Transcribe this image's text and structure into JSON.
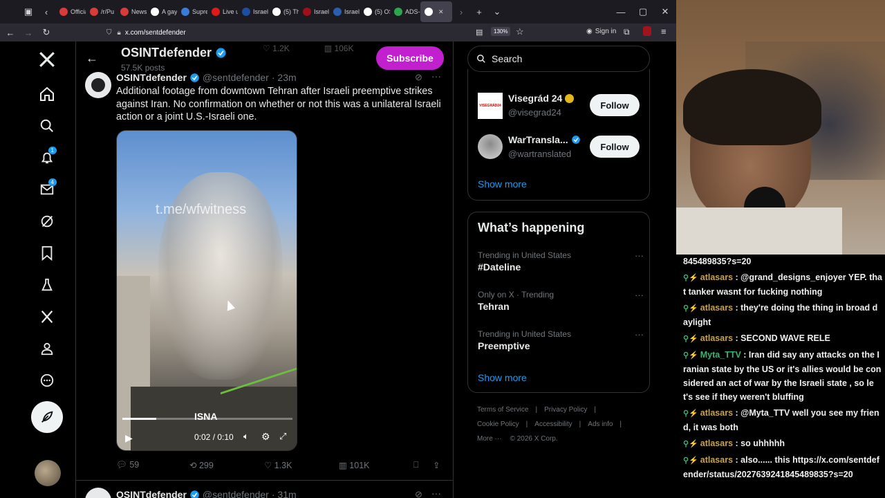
{
  "browser": {
    "tabs": [
      {
        "label": "Officia",
        "color": "#d93a3a"
      },
      {
        "label": "/r/Pu",
        "color": "#d93a3a"
      },
      {
        "label": "News",
        "color": "#d93a3a"
      },
      {
        "label": "A gay",
        "color": "#ffffff"
      },
      {
        "label": "Supre",
        "color": "#3a7bd5"
      },
      {
        "label": "Live u",
        "color": "#e01a1a"
      },
      {
        "label": "Israel",
        "color": "#1d4fa0"
      },
      {
        "label": "(5) Th",
        "color": "#ffffff"
      },
      {
        "label": "Israel",
        "color": "#a0101a"
      },
      {
        "label": "Israel",
        "color": "#2a5fb0"
      },
      {
        "label": "(5) OS",
        "color": "#ffffff"
      },
      {
        "label": "ADS-",
        "color": "#2ea44f"
      },
      {
        "label": "",
        "color": "#ffffff"
      }
    ],
    "url": "x.com/sentdefender",
    "zoom": "130%",
    "sign_in": "Sign in"
  },
  "header": {
    "name": "OSINTdefender",
    "posts": "57.5K posts",
    "subscribe": "Subscribe",
    "prev_stats": {
      "likes": "1.2K",
      "views": "106K"
    }
  },
  "tweet": {
    "name": "OSINTdefender",
    "handle": "@sentdefender",
    "time": "· 23m",
    "text": "Additional footage from downtown Tehran after Israeli preemptive strikes against Iran. No confirmation on whether or not this was a unilateral Israeli action or a joint U.S.-Israeli one.",
    "video": {
      "watermark": "t.me/wfwitness",
      "source": "ISNA",
      "time": "0:02 / 0:10",
      "progress": 0.2
    },
    "stats": {
      "replies": "59",
      "reposts": "299",
      "likes": "1.3K",
      "views": "101K"
    }
  },
  "next_tweet": {
    "name": "OSINTdefender",
    "handle": "@sentdefender",
    "time": "· 31m"
  },
  "nav": {
    "notifications_badge": "1",
    "messages_badge": "4"
  },
  "search": {
    "placeholder": "Search"
  },
  "who_to_follow": [
    {
      "name": "Visegrád 24",
      "handle": "@visegrad24",
      "follow": "Follow",
      "avatar_text": "VISEGRÁD24"
    },
    {
      "name": "WarTransla...",
      "handle": "@wartranslated",
      "follow": "Follow"
    }
  ],
  "show_more_1": "Show more",
  "whats_happening": {
    "title": "What’s happening",
    "trends": [
      {
        "meta": "Trending in United States",
        "name": "#Dateline"
      },
      {
        "meta": "Only on X · Trending",
        "name": "Tehran"
      },
      {
        "meta": "Trending in United States",
        "name": "Preemptive"
      }
    ],
    "show_more": "Show more"
  },
  "footer": {
    "terms": "Terms of Service",
    "privacy": "Privacy Policy",
    "cookie": "Cookie Policy",
    "accessibility": "Accessibility",
    "ads": "Ads info",
    "more": "More ···",
    "copyright": "© 2026 X Corp."
  },
  "chat": [
    {
      "user": "",
      "text": "845489835?s=20"
    },
    {
      "user": "atlasars",
      "text": "@grand_designs_enjoyer YEP. that tanker wasnt for fucking nothing"
    },
    {
      "user": "atlasars",
      "text": "they're doing the thing in broad daylight"
    },
    {
      "user": "atlasars",
      "text": "SECOND WAVE RELE"
    },
    {
      "user": "Myta_TTV",
      "text": "Iran did say any attacks on the Iranian state by the US or it's allies would be considered an act of war by the Israeli state , so let's see if they weren't bluffing"
    },
    {
      "user": "atlasars",
      "text": "@Myta_TTV well you see my friend, it was both"
    },
    {
      "user": "atlasars",
      "text": "so uhhhhh"
    },
    {
      "user": "atlasars",
      "text": "also...... this https://x.com/sentdefender/status/2027639241845489835?s=20"
    }
  ],
  "colors": {
    "accent": "#1d9bf0",
    "subscribe": "#c21fcf",
    "background": "#000000"
  }
}
